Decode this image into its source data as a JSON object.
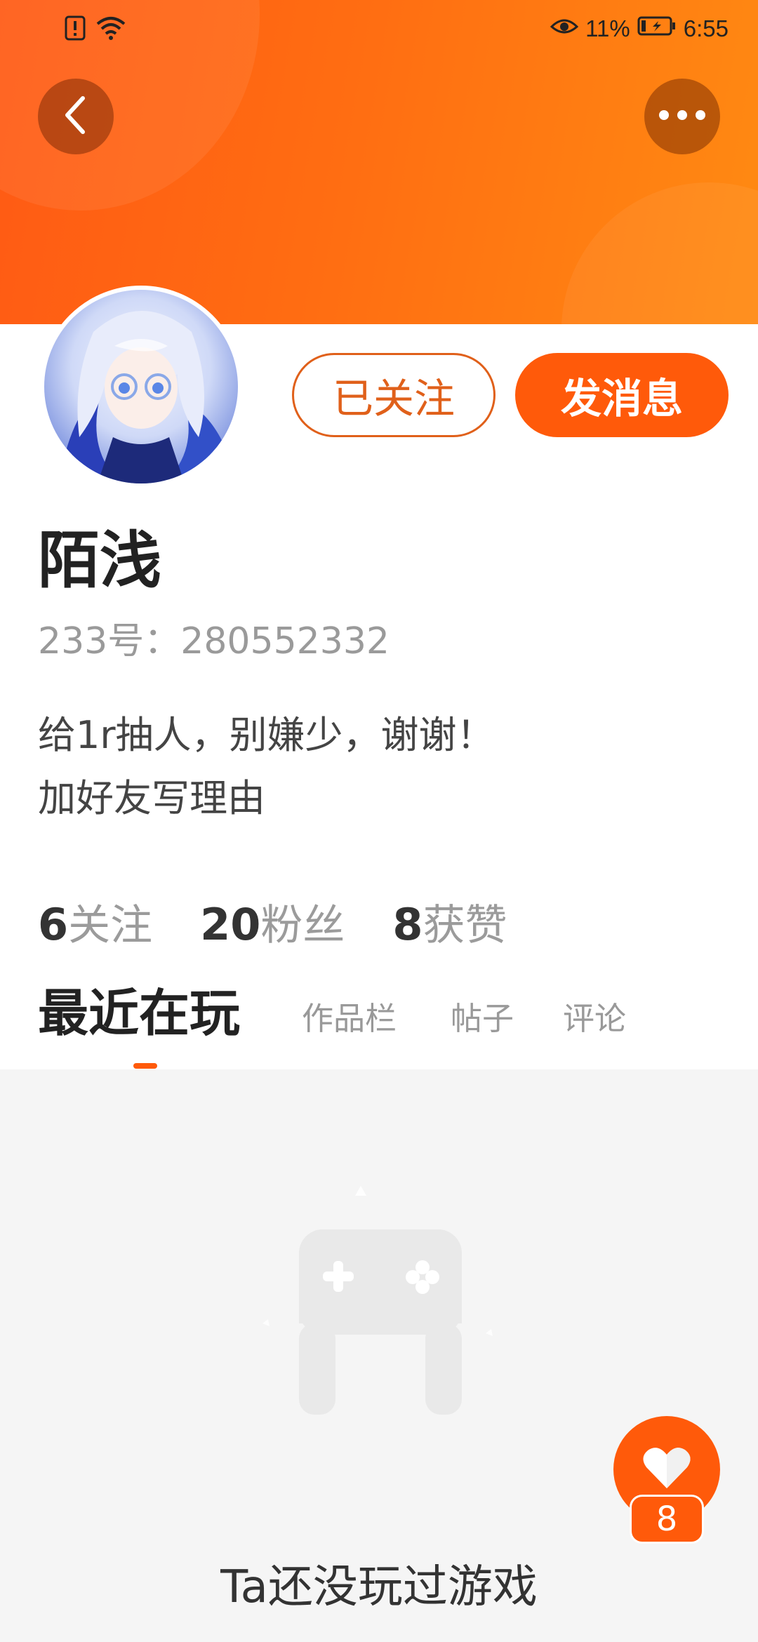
{
  "status_bar": {
    "battery_percent": "11%",
    "time": "6:55",
    "icons": [
      "alert-icon",
      "wifi-icon",
      "eye-comfort-icon",
      "battery-icon"
    ]
  },
  "header": {
    "back_icon": "chevron-left-icon",
    "more_icon": "more-dots-icon",
    "accent_color": "#ff6a10"
  },
  "profile": {
    "name": "陌浅",
    "id_line": "233号：280552332",
    "bio_lines": [
      "给1r抽人，别嫌少，谢谢！",
      "加好友写理由"
    ],
    "followed_label": "已关注",
    "message_label": "发消息"
  },
  "stats": [
    {
      "num": "6",
      "label": "关注"
    },
    {
      "num": "20",
      "label": "粉丝"
    },
    {
      "num": "8",
      "label": "获赞"
    }
  ],
  "tabs": [
    {
      "label": "最近在玩",
      "active": true
    },
    {
      "label": "作品栏",
      "active": false
    },
    {
      "label": "帖子",
      "active": false
    },
    {
      "label": "评论",
      "active": false
    }
  ],
  "empty_state": {
    "icon": "gamepad-icon",
    "text": "Ta还没玩过游戏"
  },
  "like_fab": {
    "icon": "heart-icon",
    "count": "8"
  }
}
